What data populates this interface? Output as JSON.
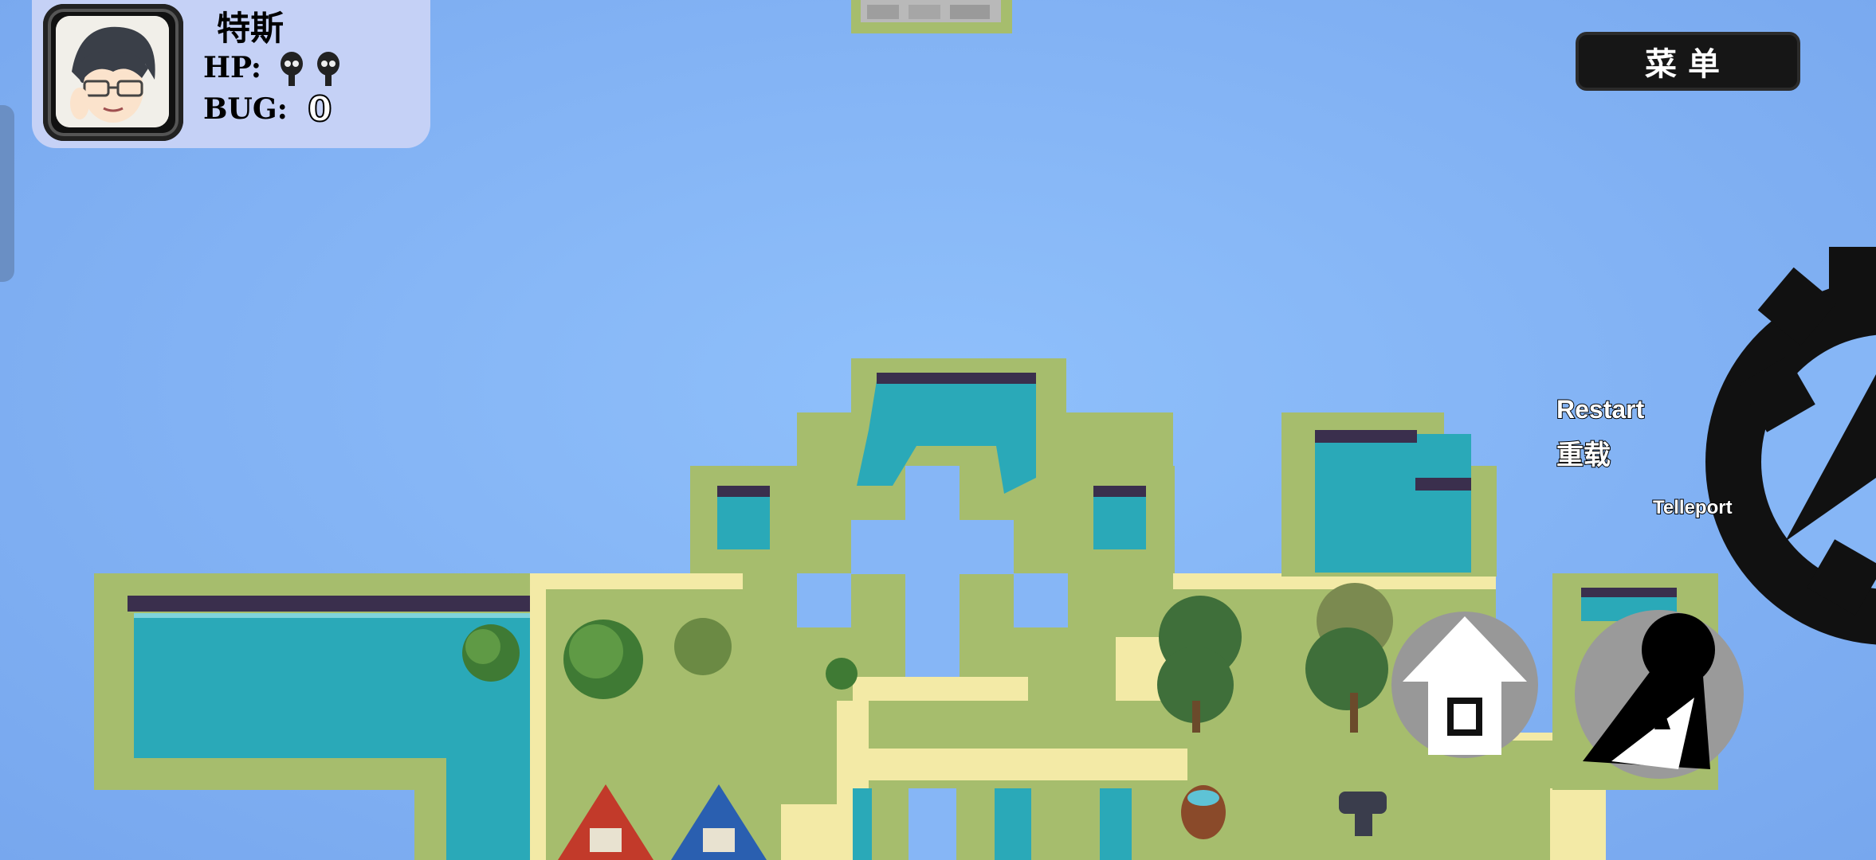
{
  "player": {
    "name": "特斯",
    "hp_label": "HP:",
    "hp_icons": 2,
    "bug_label": "BUG:",
    "bug_count": "0"
  },
  "menu": {
    "label": "菜单"
  },
  "actions": {
    "restart_label": "Restart",
    "restart_cn": "重载",
    "teleport_label": "Telleport"
  },
  "icons": {
    "avatar": "character-portrait",
    "hp": "skull-head-icon",
    "home": "home-icon",
    "keyhole": "keyhole-icon",
    "gear": "gear-icon"
  },
  "colors": {
    "sky": "#86b6f6",
    "grass": "#a6bd6d",
    "water": "#2aa9b8",
    "sand": "#f3eaa6",
    "hud_panel": "#c5d1f6"
  }
}
